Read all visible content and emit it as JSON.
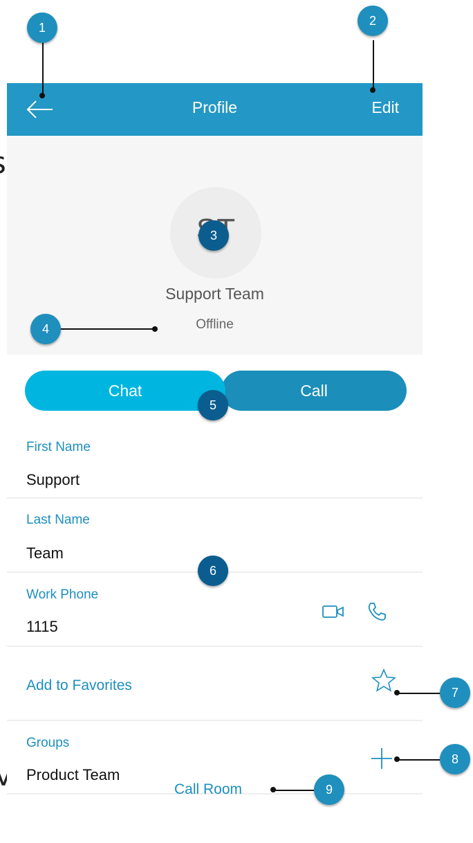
{
  "edge_fragments": [
    "s",
    "M"
  ],
  "topbar": {
    "title": "Profile",
    "edit_label": "Edit"
  },
  "contact": {
    "initials": "ST",
    "name": "Support Team",
    "status": "Offline"
  },
  "actions": {
    "chat_label": "Chat",
    "call_label": "Call"
  },
  "fields": {
    "first_name": {
      "label": "First Name",
      "value": "Support"
    },
    "last_name": {
      "label": "Last Name",
      "value": "Team"
    },
    "work_phone": {
      "label": "Work Phone",
      "value": "1115"
    }
  },
  "favorites": {
    "label": "Add to Favorites"
  },
  "groups": {
    "label": "Groups",
    "value": "Product Team"
  },
  "call_room": {
    "label": "Call Room"
  },
  "callouts": [
    "1",
    "2",
    "3",
    "4",
    "5",
    "6",
    "7",
    "8",
    "9"
  ],
  "colors": {
    "header": "#2397c5",
    "chat": "#00b6e0",
    "call": "#1b8eb9",
    "accent": "#1d8fbf",
    "badge": "#1f8fbd"
  }
}
